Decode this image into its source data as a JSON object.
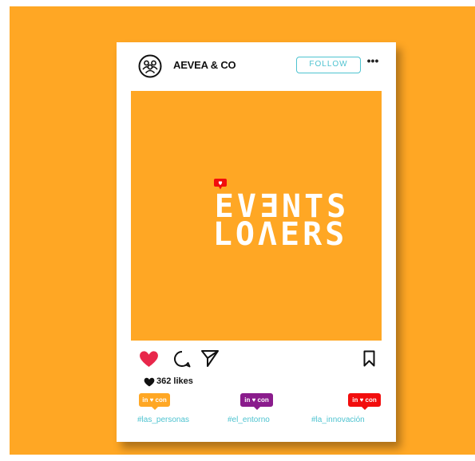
{
  "post": {
    "username": "AEVEA & CO",
    "follow_label": "FOLLOW",
    "more_label": "•••",
    "image_title_line1": "EVƎNTS",
    "image_title_line2": "LOΛERS",
    "likes_text": "362 likes"
  },
  "tags": [
    {
      "badge_label": "in ♥ con",
      "badge_color": "#FFA724",
      "hashtag": "#las_personas"
    },
    {
      "badge_label": "in ♥ con",
      "badge_color": "#8A1C8C",
      "hashtag": "#el_entorno"
    },
    {
      "badge_label": "in ♥ con",
      "badge_color": "#F20D0D",
      "hashtag": "#la_innovación"
    }
  ],
  "colors": {
    "background": "#FFA724",
    "card": "#FFFFFF",
    "follow_border": "#4EC3D0",
    "like_heart": "#E8274B",
    "notification": "#F20D0D"
  },
  "icons": [
    "group-avatar-icon",
    "more-options-icon",
    "heart-icon",
    "comment-icon",
    "send-icon",
    "bookmark-icon",
    "notification-heart-icon"
  ]
}
